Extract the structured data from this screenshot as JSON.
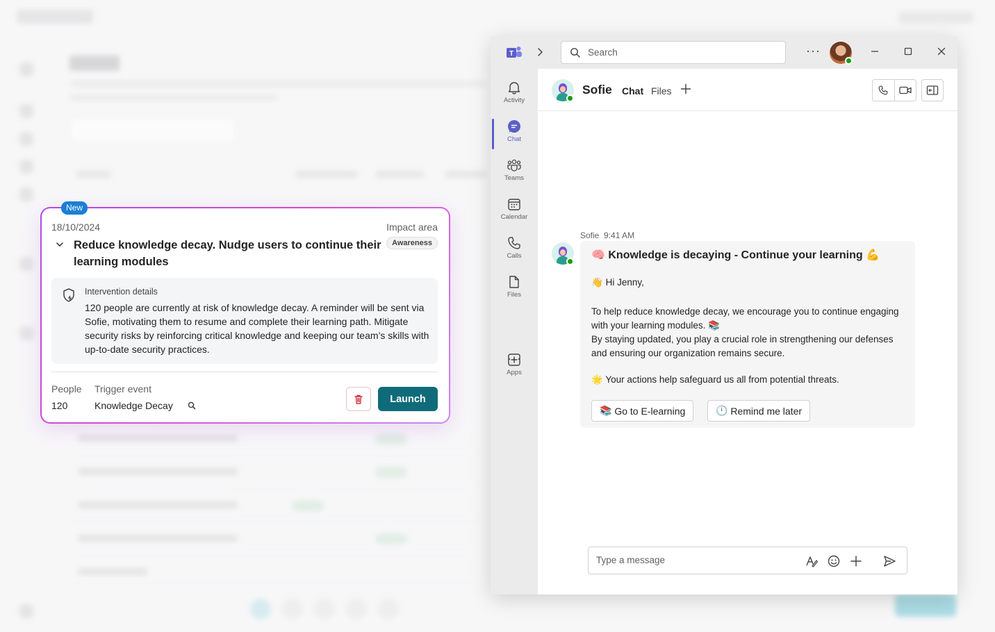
{
  "intervention_card": {
    "badge": "New",
    "date": "18/10/2024",
    "impact_label": "Impact area",
    "title": "Reduce knowledge decay. Nudge users to continue their learning modules",
    "impact_tag": "Awareness",
    "details_heading": "Intervention details",
    "details_text": "120 people are currently at risk of knowledge decay. A reminder will be sent via Sofie, motivating them to resume and complete their learning path. Mitigate security risks by reinforcing critical knowledge and keeping our team’s skills with up-to-date security practices.",
    "people_label": "People",
    "people_value": "120",
    "trigger_label": "Trigger event",
    "trigger_value": "Knowledge Decay",
    "launch_label": "Launch"
  },
  "teams": {
    "search_placeholder": "Search",
    "rail": [
      {
        "label": "Activity",
        "icon": "bell-icon"
      },
      {
        "label": "Chat",
        "icon": "chat-icon",
        "active": true
      },
      {
        "label": "Teams",
        "icon": "teams-icon"
      },
      {
        "label": "Calendar",
        "icon": "calendar-icon"
      },
      {
        "label": "Calls",
        "icon": "phone-icon"
      },
      {
        "label": "Files",
        "icon": "file-icon"
      },
      {
        "label": "Apps",
        "icon": "apps-icon"
      }
    ],
    "chat": {
      "name": "Sofie",
      "tab_chat": "Chat",
      "tab_files": "Files"
    },
    "message": {
      "sender": "Sofie",
      "time": "9:41 AM",
      "title_emoji": "🧠",
      "title": "Knowledge is decaying - Continue your learning",
      "title_emoji_end": "💪",
      "greeting_emoji": "👋",
      "greeting": "Hi Jenny,",
      "body_1": "To help reduce knowledge decay, we encourage you to continue engaging with your learning modules.",
      "body_1_emoji": "📚",
      "body_2": "By staying updated, you play a crucial role in strengthening our defenses and ensuring our organization remains secure.",
      "safe_emoji": "🌟",
      "safe": "Your actions help safeguard us all from potential threats.",
      "btn_elearning_emoji": "📚",
      "btn_elearning": "Go to E-learning",
      "btn_remind_emoji": "🕛",
      "btn_remind": "Remind me later"
    },
    "compose_placeholder": "Type a message"
  },
  "colors": {
    "teams_accent": "#5b5fc7",
    "launch": "#0f6b7a",
    "new_badge": "#1a7fd4",
    "card_border": "#d64bd0",
    "presence": "#13a10e"
  }
}
